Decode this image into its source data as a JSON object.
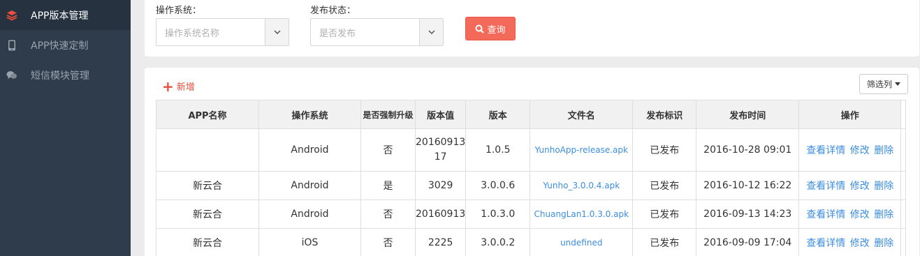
{
  "sidebar": {
    "items": [
      {
        "label": "APP版本管理",
        "icon": "layers-icon",
        "active": true
      },
      {
        "label": "APP快速定制",
        "icon": "mobile-icon",
        "active": false
      },
      {
        "label": "短信模块管理",
        "icon": "chat-icon",
        "active": false
      }
    ]
  },
  "filter": {
    "os_label": "操作系统：",
    "os_placeholder": "操作系统名称",
    "status_label": "发布状态：",
    "status_placeholder": "是否发布",
    "query_label": "查询"
  },
  "toolbar": {
    "add_label": "新增",
    "columns_label": "筛选列"
  },
  "table": {
    "headers": [
      "APP名称",
      "操作系统",
      "是否强制升级",
      "版本值",
      "版本",
      "文件名",
      "发布标识",
      "发布时间",
      "操作"
    ],
    "rows": [
      {
        "name": "",
        "os": "Android",
        "force": "否",
        "ver_value_1": "20160913",
        "ver_value_2": "17",
        "version": "1.0.5",
        "file": "YunhoApp-release.apk",
        "status": "已发布",
        "time": "2016-10-28 09:01"
      },
      {
        "name": "新云合",
        "os": "Android",
        "force": "是",
        "ver_value_1": "3029",
        "ver_value_2": "",
        "version": "3.0.0.6",
        "file": "Yunho_3.0.0.4.apk",
        "status": "已发布",
        "time": "2016-10-12 16:22"
      },
      {
        "name": "新云合",
        "os": "Android",
        "force": "否",
        "ver_value_1": "20160913",
        "ver_value_2": "",
        "version": "1.0.3.0",
        "file": "ChuangLan1.0.3.0.apk",
        "status": "已发布",
        "time": "2016-09-13 14:23"
      },
      {
        "name": "新云合",
        "os": "iOS",
        "force": "否",
        "ver_value_1": "2225",
        "ver_value_2": "",
        "version": "3.0.0.2",
        "file": "undefined",
        "status": "已发布",
        "time": "2016-09-09 17:04"
      }
    ],
    "actions": {
      "view": "查看详情",
      "edit": "修改",
      "delete": "删除"
    }
  },
  "colors": {
    "sidebar_bg": "#2f3c4b",
    "accent": "#e94f3c",
    "link": "#3c8dde",
    "query_btn": "#f46a5a"
  }
}
